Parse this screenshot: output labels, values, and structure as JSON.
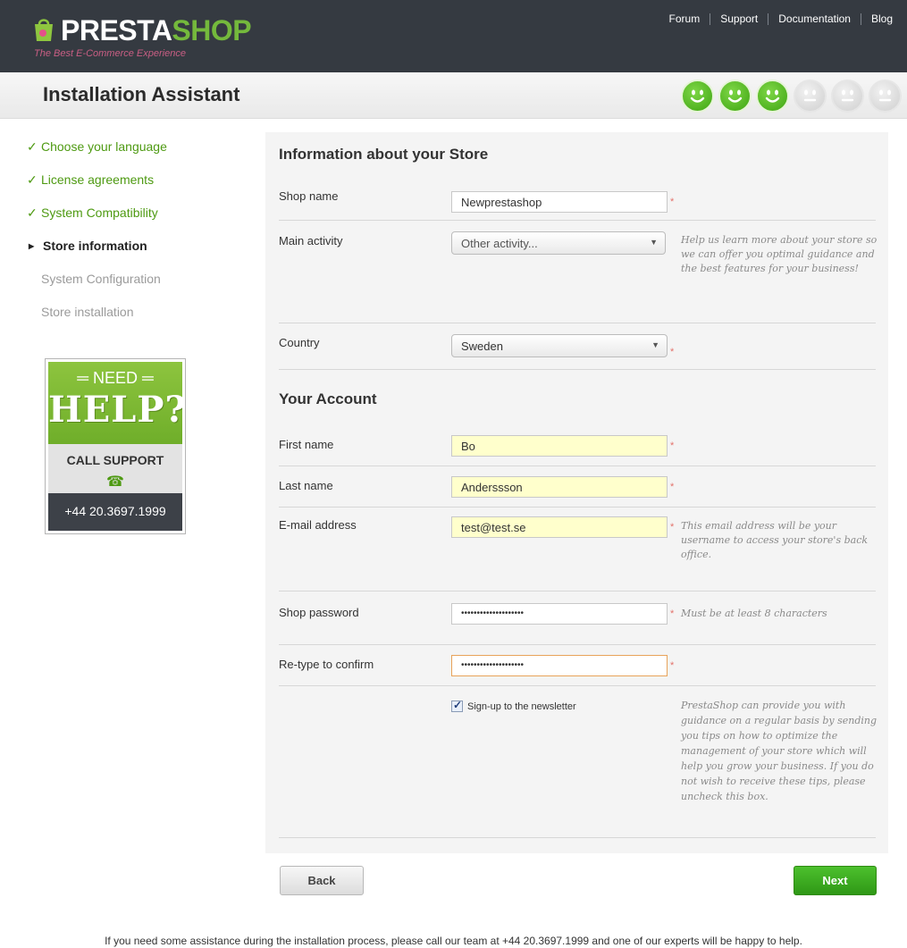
{
  "brand": {
    "name_part1": "PRESTA",
    "name_part2": "SHOP",
    "tagline": "The Best E-Commerce Experience"
  },
  "top_links": [
    "Forum",
    "Support",
    "Documentation",
    "Blog"
  ],
  "page_title": "Installation Assistant",
  "progress": {
    "completed": 3,
    "total": 6
  },
  "steps": [
    {
      "label": "Choose your language",
      "state": "done"
    },
    {
      "label": "License agreements",
      "state": "done"
    },
    {
      "label": "System Compatibility",
      "state": "done"
    },
    {
      "label": "Store information",
      "state": "current"
    },
    {
      "label": "System Configuration",
      "state": "todo"
    },
    {
      "label": "Store installation",
      "state": "todo"
    }
  ],
  "help_box": {
    "need": "NEED",
    "help": "HELP?",
    "call": "CALL SUPPORT",
    "phone": "+44 20.3697.1999"
  },
  "store_section": {
    "title": "Information about your Store",
    "shop_name": {
      "label": "Shop name",
      "value": "Newprestashop"
    },
    "main_activity": {
      "label": "Main activity",
      "value": "Other activity...",
      "hint": "Help us learn more about your store so we can offer you optimal guidance and the best features for your business!"
    },
    "country": {
      "label": "Country",
      "value": "Sweden"
    }
  },
  "account_section": {
    "title": "Your Account",
    "first_name": {
      "label": "First name",
      "value": "Bo"
    },
    "last_name": {
      "label": "Last name",
      "value": "Anderssson"
    },
    "email": {
      "label": "E-mail address",
      "value": "test@test.se",
      "hint": "This email address will be your username to access your store's back office."
    },
    "password": {
      "label": "Shop password",
      "value": "••••••••••••••••••••",
      "hint": "Must be at least 8 characters"
    },
    "confirm": {
      "label": "Re-type to confirm",
      "value": "••••••••••••••••••••"
    },
    "newsletter": {
      "label": "Sign-up to the newsletter",
      "checked": true,
      "hint": "PrestaShop can provide you with guidance on a regular basis by sending you tips on how to optimize the management of your store which will help you grow your business. If you do not wish to receive these tips, please uncheck this box."
    }
  },
  "required_mark": "*",
  "buttons": {
    "back": "Back",
    "next": "Next"
  },
  "footer": "If you need some assistance during the installation process, please call our team at +44 20.3697.1999 and one of our experts will be happy to help.",
  "colors": {
    "header_bg": "#353a41",
    "brand_green": "#74b93c",
    "done_step": "#4e9a12",
    "next_button": "#3aa91f",
    "required": "#e3716a",
    "input_highlight": "#ffffcc"
  }
}
